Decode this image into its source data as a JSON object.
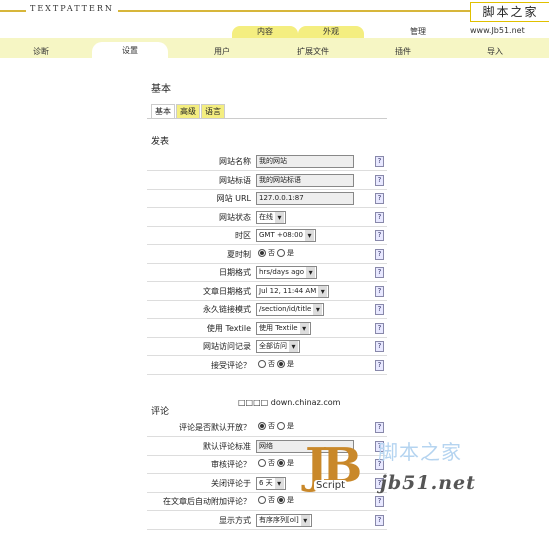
{
  "header": {
    "logo_text": "TEXTPATTERN",
    "watermark_text": "脚本之家"
  },
  "top_tabs": [
    {
      "label": "内容"
    },
    {
      "label": "外观"
    },
    {
      "label": "管理"
    },
    {
      "label": "www.Jb51.net"
    }
  ],
  "sub_tabs": [
    {
      "label": "诊断"
    },
    {
      "label": "设置"
    },
    {
      "label": "用户"
    },
    {
      "label": "扩展文件"
    },
    {
      "label": "插件"
    },
    {
      "label": "导入"
    }
  ],
  "page_title": "基本",
  "pref_tabs": [
    {
      "label": "基本"
    },
    {
      "label": "高级"
    },
    {
      "label": "语言"
    }
  ],
  "section_publish": "发表",
  "publish_rows": [
    {
      "label": "网站名称",
      "type": "text",
      "value": "我的网站"
    },
    {
      "label": "网站标语",
      "type": "text",
      "value": "我的网站标语"
    },
    {
      "label": "网站 URL",
      "type": "text",
      "value": "127.0.0.1:87"
    },
    {
      "label": "网站状态",
      "type": "select",
      "value": "在线"
    },
    {
      "label": "时区",
      "type": "select",
      "value": "GMT +08:00"
    },
    {
      "label": "夏时制",
      "type": "radio",
      "options": [
        "否",
        "是"
      ],
      "selected": 0
    },
    {
      "label": "日期格式",
      "type": "select",
      "value": "hrs/days ago"
    },
    {
      "label": "文章日期格式",
      "type": "select",
      "value": "Jul 12, 11:44 AM"
    },
    {
      "label": "永久链接模式",
      "type": "select",
      "value": "/section/id/title"
    },
    {
      "label": "使用 Textile",
      "type": "select",
      "value": "使用 Textile"
    },
    {
      "label": "网站访问记录",
      "type": "select",
      "value": "全部访问"
    },
    {
      "label": "接受评论？",
      "type": "radio",
      "options": [
        "否",
        "是"
      ],
      "selected": 1
    }
  ],
  "mid_note": "□□□□ down.chinaz.com",
  "section_comments": "评论",
  "comment_rows": [
    {
      "label": "评论是否默认开放？",
      "type": "radio",
      "options": [
        "否",
        "是"
      ],
      "selected": 0
    },
    {
      "label": "默认评论标准",
      "type": "text",
      "value": "网络"
    },
    {
      "label": "审核评论？",
      "type": "radio",
      "options": [
        "否",
        "是"
      ],
      "selected": 1
    },
    {
      "label": "关闭评论于",
      "type": "select",
      "value": "6 天"
    },
    {
      "label": "在文章后自动附加评论？",
      "type": "radio",
      "options": [
        "否",
        "是"
      ],
      "selected": 1
    },
    {
      "label": "显示方式",
      "type": "select",
      "value": "有序序列[ol]"
    }
  ],
  "help_symbol": "?",
  "watermark": {
    "cn": "脚本之家",
    "url": "jb51.net",
    "badge": "Script"
  }
}
